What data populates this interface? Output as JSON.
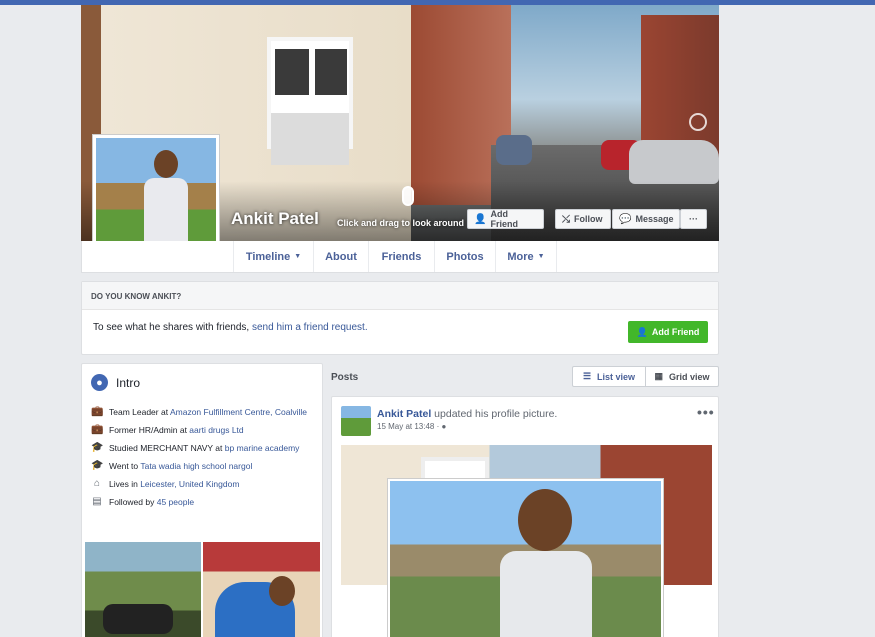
{
  "profile": {
    "name": "Ankit Patel",
    "cover_hint": "Click and drag to look around"
  },
  "actions": {
    "add_friend": "Add Friend",
    "follow": "Follow",
    "message": "Message",
    "more": "···"
  },
  "nav": {
    "tabs": [
      {
        "label": "Timeline"
      },
      {
        "label": "About"
      },
      {
        "label": "Friends"
      },
      {
        "label": "Photos"
      },
      {
        "label": "More"
      }
    ]
  },
  "know": {
    "heading": "DO YOU KNOW ANKIT?",
    "text_before": "To see what he shares with friends, ",
    "link": "send him a friend request.",
    "button": "Add Friend"
  },
  "intro": {
    "title": "Intro",
    "items": [
      {
        "prefix": "Team Leader at ",
        "link": "Amazon Fulfillment Centre, Coalville",
        "icon": "briefcase-icon"
      },
      {
        "prefix": "Former HR/Admin at ",
        "link": "aarti drugs Ltd",
        "icon": "briefcase-icon"
      },
      {
        "prefix": "Studied MERCHANT NAVY at ",
        "link": "bp marine academy",
        "icon": "graduation-cap-icon"
      },
      {
        "prefix": "Went to ",
        "link": "Tata wadia high school nargol",
        "icon": "graduation-cap-icon"
      },
      {
        "prefix": "Lives in ",
        "link": "Leicester, United Kingdom",
        "icon": "home-icon"
      },
      {
        "prefix": "Followed by ",
        "link": "45 people",
        "icon": "followers-icon"
      }
    ]
  },
  "posts": {
    "label": "Posts",
    "list_view": "List view",
    "grid_view": "Grid view",
    "post": {
      "author": "Ankit Patel",
      "action": " updated his profile picture.",
      "time": "15 May at 13:48 · ",
      "more": "•••"
    }
  },
  "colors": {
    "brand": "#4267b2",
    "link": "#385898",
    "green": "#42b72a",
    "background": "#e9ebee"
  }
}
